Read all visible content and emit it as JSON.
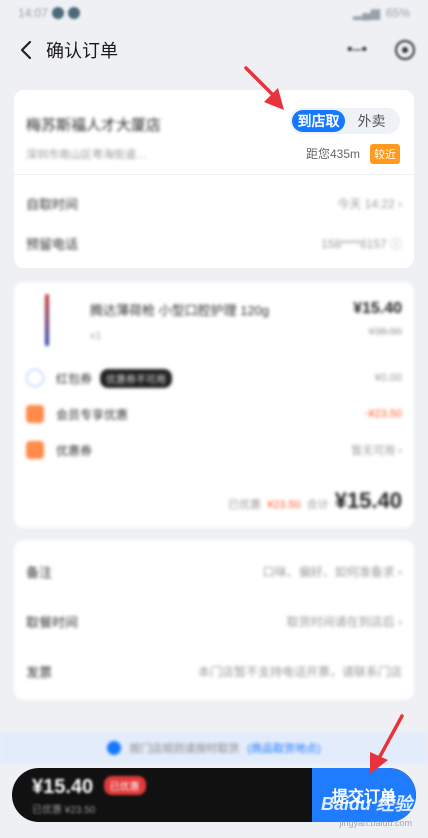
{
  "status_bar": {
    "time": "14:07",
    "battery": "65%"
  },
  "header": {
    "title": "确认订单",
    "back_icon": "chevron-left-icon"
  },
  "store": {
    "name": "梅苏斯福人才大厦店",
    "address": "深圳市南山区粤海街道…",
    "modes": [
      "到店取",
      "外卖"
    ],
    "active_mode": "到店取",
    "distance": "距您435m",
    "near_tag": "较近",
    "pickup_label": "自取时间",
    "pickup_value": "今天 14:22 ›",
    "phone_label": "预留电话",
    "phone_value": "158****6157 ⓘ"
  },
  "product": {
    "name": "腾达薄荷枪 小型口腔护理 120g",
    "qty": "x1",
    "price": "¥15.40",
    "orig_price": "¥38.90"
  },
  "options": [
    {
      "label": "红包券",
      "badge": "优惠券不可用",
      "value": "¥0.00",
      "icon": "circle",
      "red": false
    },
    {
      "label": "会员专享优惠",
      "badge": "",
      "value": "-¥23.50",
      "icon": "orange",
      "red": true
    },
    {
      "label": "优惠券",
      "badge": "",
      "value": "暂无可用 ›",
      "icon": "orange",
      "red": false
    }
  ],
  "totals": {
    "saved_label": "已优惠",
    "saved_value": "¥23.50",
    "sum_label": "合计",
    "amount": "¥15.40"
  },
  "notes": [
    {
      "label": "备注",
      "value": "口味、偏好、如何准备求 ›"
    },
    {
      "label": "取餐时间",
      "value": "取货时间请在到店后 ›"
    },
    {
      "label": "发票",
      "value": "本门店暂不支持电话开票，请联系门店"
    }
  ],
  "tip": {
    "text": "按门店规则请按时取货",
    "link": "(商品取货地点)"
  },
  "bottom_bar": {
    "price": "¥15.40",
    "badge": "已优惠",
    "sub": "已优惠 ¥23.50",
    "submit": "提交订单"
  },
  "watermark": {
    "brand": "Baidu 经验",
    "url": "jingyan.baidu.com"
  },
  "colors": {
    "accent": "#1677ff",
    "annotation": "#e8323c",
    "warning": "#ff9a1e"
  }
}
